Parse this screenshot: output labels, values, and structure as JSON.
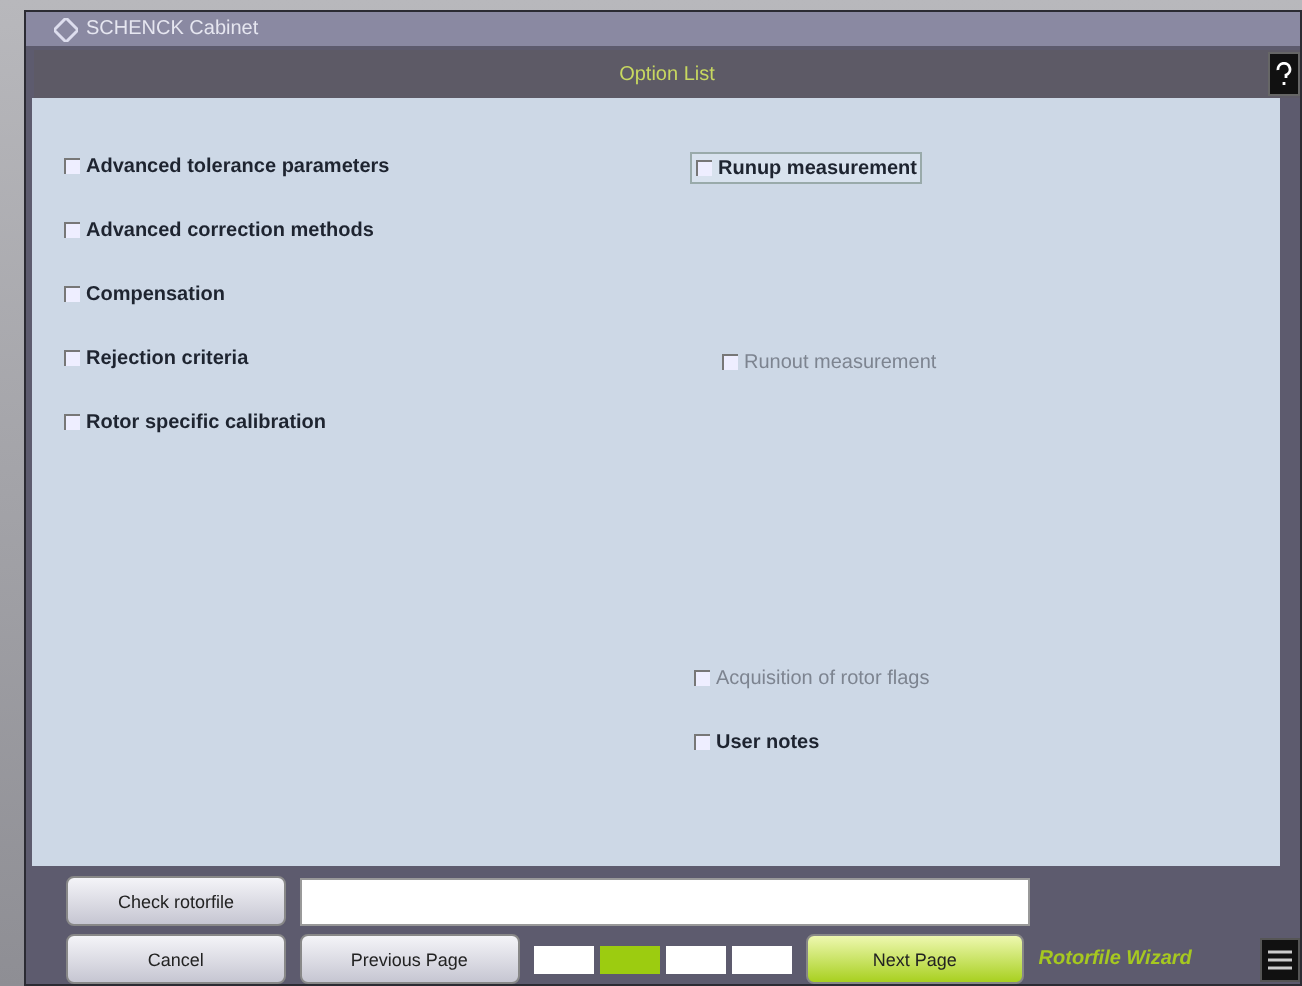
{
  "window": {
    "title": "SCHENCK Cabinet"
  },
  "header": {
    "title": "Option List"
  },
  "left_options": [
    {
      "label": "Advanced tolerance parameters",
      "checked": false,
      "disabled": false,
      "focused": false
    },
    {
      "label": "Advanced correction methods",
      "checked": false,
      "disabled": false,
      "focused": false
    },
    {
      "label": "Compensation",
      "checked": false,
      "disabled": false,
      "focused": false
    },
    {
      "label": "Rejection criteria",
      "checked": false,
      "disabled": false,
      "focused": false
    },
    {
      "label": "Rotor specific calibration",
      "checked": false,
      "disabled": false,
      "focused": false
    }
  ],
  "right_options": [
    {
      "label": "Runup measurement",
      "checked": false,
      "disabled": false,
      "focused": true
    },
    {
      "label": "Runout measurement",
      "checked": false,
      "disabled": true,
      "focused": false
    },
    {
      "label": "Acquisition of rotor flags",
      "checked": false,
      "disabled": true,
      "focused": false
    },
    {
      "label": "User notes",
      "checked": false,
      "disabled": false,
      "focused": false
    }
  ],
  "footer": {
    "check_button": "Check rotorfile",
    "cancel_button": "Cancel",
    "previous_button": "Previous Page",
    "next_button": "Next Page",
    "logo": "Rotorfile Wizard",
    "pages": [
      {
        "selected": false
      },
      {
        "selected": true
      },
      {
        "selected": false
      },
      {
        "selected": false
      }
    ]
  }
}
